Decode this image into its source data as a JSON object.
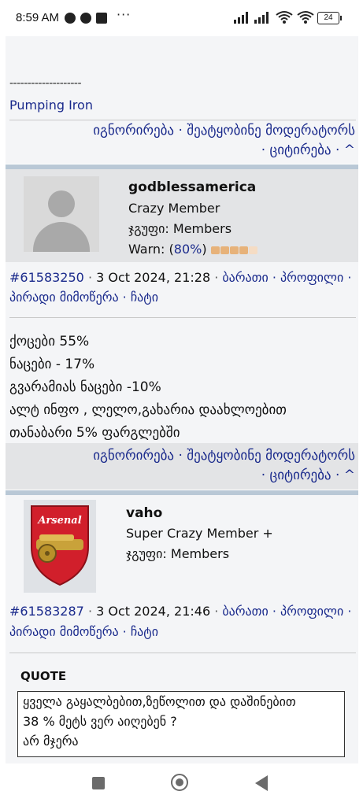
{
  "status_bar": {
    "time": "8:59 AM",
    "dots": "···",
    "battery": "24"
  },
  "post_top": {
    "truncated_line": "",
    "signature_rule": "--------------------",
    "signature_link": "Pumping Iron",
    "actions_line1": "იგნორირება · შეატყობინე მოდერატორს",
    "actions_line2": "· ციტირება · ^"
  },
  "post1": {
    "username": "godblessamerica",
    "rank": "Crazy Member",
    "group_label": "ჯგუფი:",
    "group": "Members",
    "warn_label": "Warn: (",
    "warn_value": "80%",
    "warn_close": ")",
    "warn_level": 0.8,
    "post_id": "#61583250",
    "date": "3 Oct 2024, 21:28",
    "links_line1": "ბარათი · პროფილი ·",
    "links_line2": "პირადი მიმოწერა · ჩატი",
    "body": [
      "ქოცები 55%",
      "ნაცები - 17%",
      "გვარამიას ნაცები -10%",
      "ალტ ინფო , ლელო,გახარია დაახლოებით",
      "თანაბარი 5% ფარგლებში"
    ],
    "actions_line1": "იგნორირება · შეატყობინე მოდერატორს",
    "actions_line2": "· ციტირება · ^"
  },
  "post2": {
    "username": "vaho",
    "rank": "Super Crazy Member +",
    "group_label": "ჯგუფი:",
    "group": "Members",
    "avatar_text": "Arsenal",
    "post_id": "#61583287",
    "date": "3 Oct 2024, 21:46",
    "links_line1": "ბარათი · პროფილი ·",
    "links_line2": "პირადი მიმოწერა · ჩატი",
    "quote_label": "QUOTE",
    "quote_lines": [
      "ყველა გაყალბებით,ზეწოლით და დაშინებით",
      "38 % მეტს ვერ აიღებენ ?",
      "არ მჯერა"
    ]
  },
  "colors": {
    "link": "#1a2a8c",
    "separator": "#b9c8d6",
    "profile_bg": "#e3e4e6",
    "post_bg": "#f4f5f7"
  }
}
